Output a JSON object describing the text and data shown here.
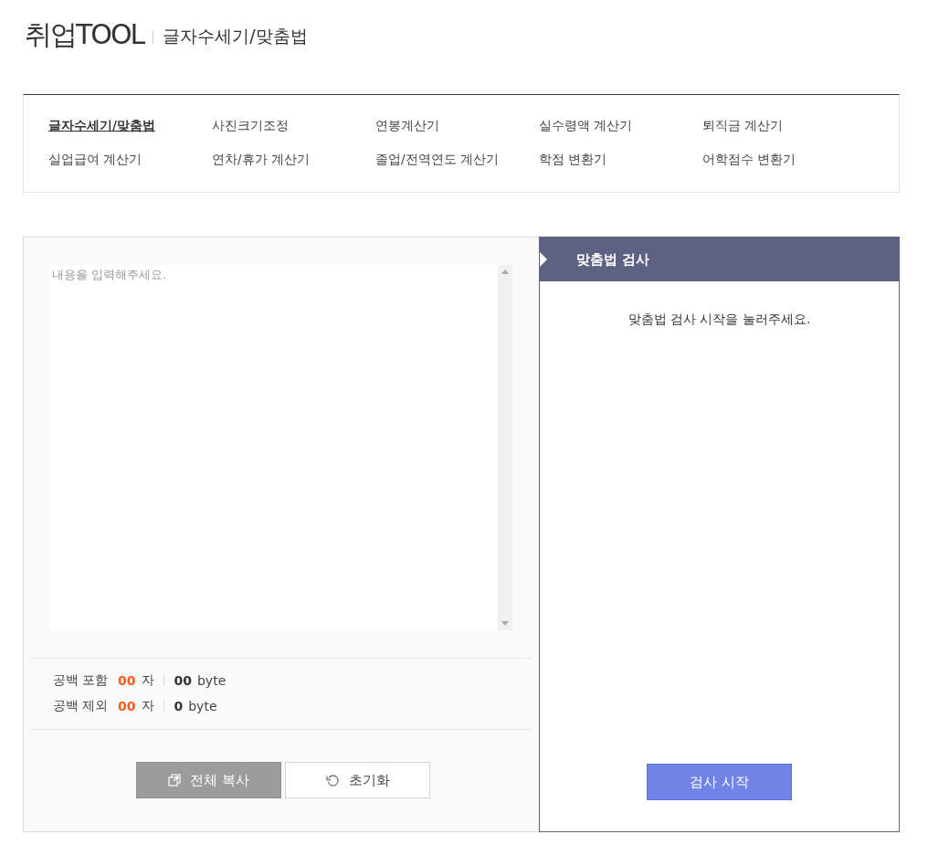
{
  "header": {
    "logo": "취업TOOL",
    "page_title": "글자수세기/맞춤법"
  },
  "nav": [
    {
      "label": "글자수세기/맞춤법",
      "selected": true
    },
    {
      "label": "사진크기조정",
      "selected": false
    },
    {
      "label": "연봉계산기",
      "selected": false
    },
    {
      "label": "실수령액 계산기",
      "selected": false
    },
    {
      "label": "퇴직금 계산기",
      "selected": false
    },
    {
      "label": "실업급여 계산기",
      "selected": false
    },
    {
      "label": "연차/휴가 계산기",
      "selected": false
    },
    {
      "label": "졸업/전역연도 계산기",
      "selected": false
    },
    {
      "label": "학점 변환기",
      "selected": false
    },
    {
      "label": "어학점수 변환기",
      "selected": false
    }
  ],
  "editor": {
    "placeholder": "내용을 입력해주세요."
  },
  "stats": [
    {
      "label": "공백 포함",
      "chars": "00",
      "char_unit": "자",
      "bytes": "00",
      "byte_unit": "byte"
    },
    {
      "label": "공백 제외",
      "chars": "00",
      "char_unit": "자",
      "bytes": "0",
      "byte_unit": "byte"
    }
  ],
  "buttons": [
    {
      "kind": "copy",
      "label": "전체 복사"
    },
    {
      "kind": "reset",
      "label": "초기화"
    }
  ],
  "spellcheck": {
    "title": "맞춤법 검사",
    "message": "맞춤법 검사 시작을 눌러주세요.",
    "button": "검사 시작"
  }
}
